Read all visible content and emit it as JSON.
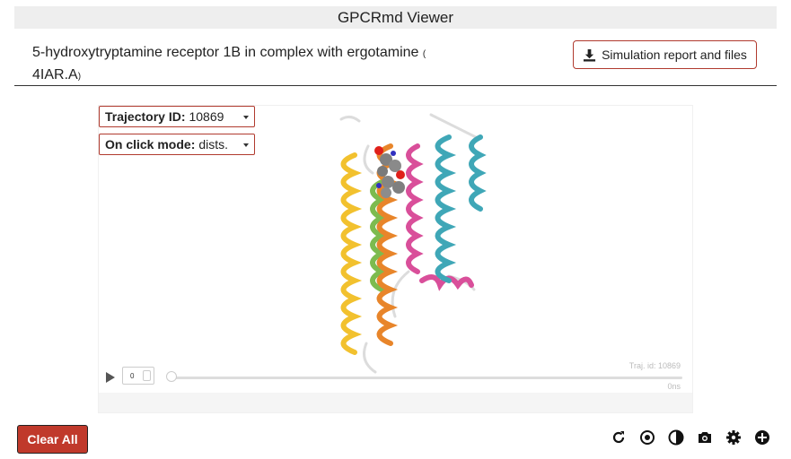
{
  "header": {
    "app_title": "GPCRmd Viewer",
    "molecule_name": "5-hydroxytryptamine receptor 1B in complex with ergotamine",
    "paren_open": "(",
    "pdb_id": "4IAR.A",
    "paren_close": ")",
    "report_button_label": "Simulation report and files",
    "report_icon": "download-icon"
  },
  "viewer": {
    "trajectory_select": {
      "label": "Trajectory ID:",
      "value": "10869"
    },
    "click_mode_select": {
      "label": "On click mode:",
      "value": "dists."
    },
    "player": {
      "frame_value": "0",
      "traj_id_label": "Traj. id: 10869",
      "time_label": "0ns",
      "progress": 0
    },
    "structure_colors": {
      "tm1": "#f2c12e",
      "tm2": "#7dbb4f",
      "tm3": "#e8852a",
      "tm5": "#d94f9a",
      "tm6": "#3fa7b7",
      "loops": "#e8e8e8",
      "ligand": "#808080",
      "oxygen": "#e0201a",
      "nitrogen": "#3030c0"
    }
  },
  "controls": {
    "clear_all_label": "Clear All",
    "clear_all_color": "#c0392b",
    "icons": [
      "refresh-icon",
      "center-icon",
      "contrast-icon",
      "camera-icon",
      "settings-icon",
      "add-icon"
    ]
  }
}
